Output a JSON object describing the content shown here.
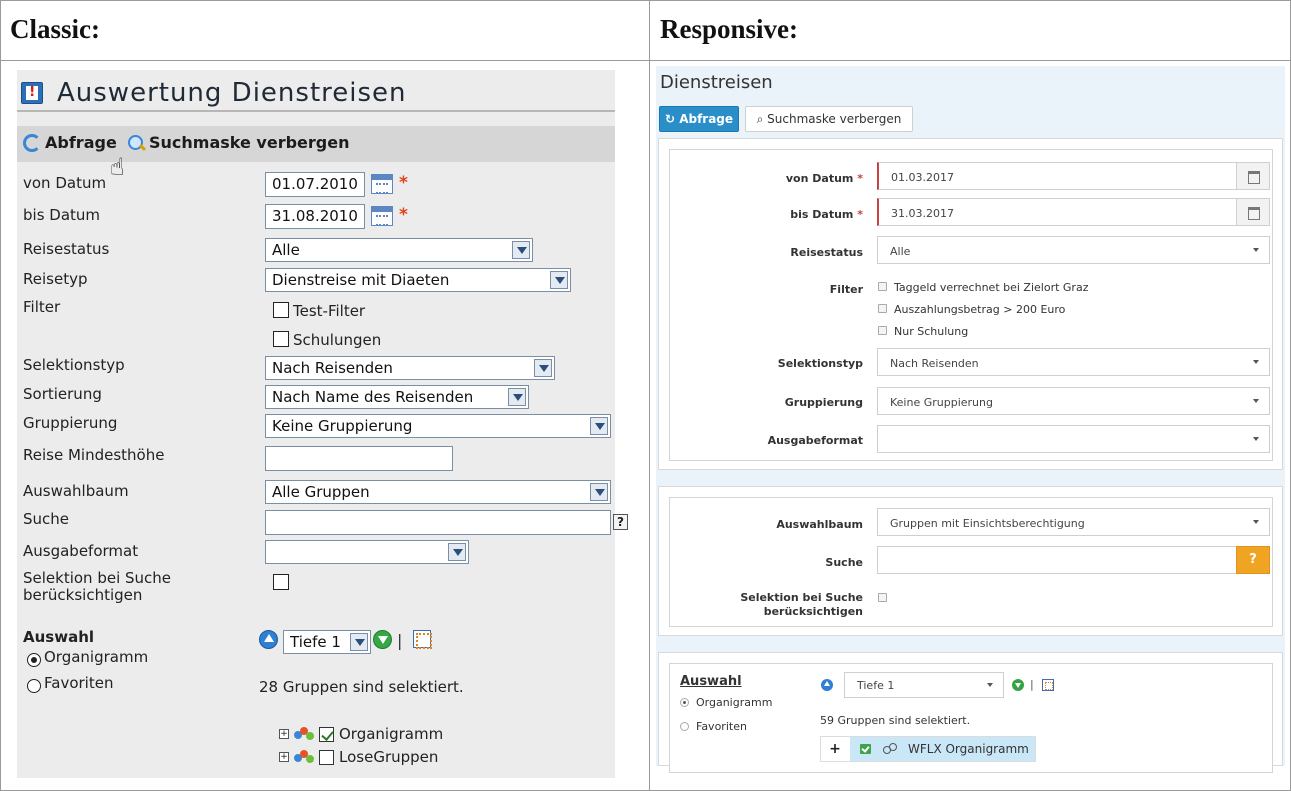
{
  "headers": {
    "classic": "Classic:",
    "responsive": "Responsive:"
  },
  "classic": {
    "title": "Auswertung Dienstreisen",
    "toolbar": {
      "query": "Abfrage",
      "hide_search": "Suchmaske verbergen"
    },
    "fields": {
      "von_datum": {
        "label": "von Datum",
        "value": "01.07.2010"
      },
      "bis_datum": {
        "label": "bis Datum",
        "value": "31.08.2010"
      },
      "reisestatus": {
        "label": "Reisestatus",
        "value": "Alle"
      },
      "reisetyp": {
        "label": "Reisetyp",
        "value": "Dienstreise mit Diaeten"
      },
      "filter": {
        "label": "Filter",
        "options": [
          "Test-Filter",
          "Schulungen"
        ]
      },
      "selektionstyp": {
        "label": "Selektionstyp",
        "value": "Nach Reisenden"
      },
      "sortierung": {
        "label": "Sortierung",
        "value": "Nach Name des Reisenden"
      },
      "gruppierung": {
        "label": "Gruppierung",
        "value": "Keine Gruppierung"
      },
      "reise_mindesthoehe": {
        "label": "Reise Mindesthöhe",
        "value": ""
      },
      "auswahlbaum": {
        "label": "Auswahlbaum",
        "value": "Alle Gruppen"
      },
      "suche": {
        "label": "Suche",
        "value": "",
        "help": "?"
      },
      "ausgabeformat": {
        "label": "Ausgabeformat",
        "value": ""
      },
      "selektion": {
        "label_line1": "Selektion bei Suche",
        "label_line2": "berücksichtigen"
      }
    },
    "required_mark": "*",
    "auswahl": {
      "label": "Auswahl",
      "radios": [
        "Organigramm",
        "Favoriten"
      ],
      "depth": "Tiefe 1",
      "separator": "|",
      "info": "28 Gruppen sind selektiert.",
      "tree": [
        {
          "label": "Organigramm",
          "checked": true
        },
        {
          "label": "LoseGruppen",
          "checked": false
        }
      ],
      "expand": "+"
    }
  },
  "responsive": {
    "title": "Dienstreisen",
    "toolbar": {
      "query": "Abfrage",
      "hide_search": "Suchmaske verbergen"
    },
    "fields": {
      "von_datum": {
        "label": "von Datum",
        "value": "01.03.2017"
      },
      "bis_datum": {
        "label": "bis Datum",
        "value": "31.03.2017"
      },
      "reisestatus": {
        "label": "Reisestatus",
        "value": "Alle"
      },
      "filter": {
        "label": "Filter",
        "options": [
          "Taggeld verrechnet bei Zielort Graz",
          "Auszahlungsbetrag > 200 Euro",
          "Nur Schulung"
        ]
      },
      "selektionstyp": {
        "label": "Selektionstyp",
        "value": "Nach Reisenden"
      },
      "gruppierung": {
        "label": "Gruppierung",
        "value": "Keine Gruppierung"
      },
      "ausgabeformat": {
        "label": "Ausgabeformat",
        "value": ""
      },
      "auswahlbaum": {
        "label": "Auswahlbaum",
        "value": "Gruppen mit Einsichtsberechtigung"
      },
      "suche": {
        "label": "Suche",
        "value": "",
        "help": "?"
      },
      "selektion": {
        "label_line1": "Selektion bei Suche",
        "label_line2": "berücksichtigen"
      }
    },
    "required_mark": "*",
    "auswahl": {
      "label": "Auswahl",
      "radios": [
        "Organigramm",
        "Favoriten"
      ],
      "depth": "Tiefe 1",
      "separator": "|",
      "info": "59 Gruppen sind selektiert.",
      "tree": [
        {
          "label": "WFLX Organigramm",
          "checked": true
        }
      ],
      "expand": "+"
    }
  },
  "colors": {
    "primary_button": "#2a8fc9",
    "help_button": "#f0a424",
    "required": "#c94141",
    "selected_tree": "#c9e7f7"
  }
}
